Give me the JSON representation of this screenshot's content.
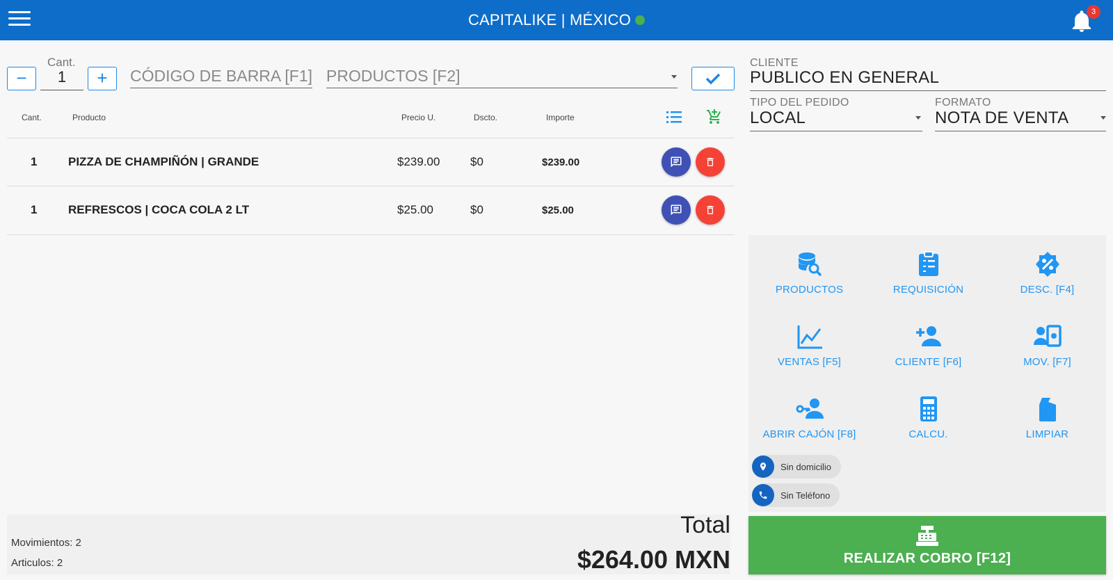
{
  "header": {
    "title": "CAPITALIKE | MÉXICO",
    "notifications": "3"
  },
  "entry": {
    "qty_label": "Cant.",
    "qty_value": "1",
    "barcode_placeholder": "CÓDIGO DE BARRA [F1]",
    "products_placeholder": "PRODUCTOS [F2]"
  },
  "table": {
    "headers": {
      "qty": "Cant.",
      "product": "Producto",
      "price": "Precio U.",
      "discount": "Dscto.",
      "amount": "Importe"
    },
    "rows": [
      {
        "qty": "1",
        "product": "PIZZA DE CHAMPIÑÓN | GRANDE",
        "price": "$239.00",
        "discount": "$0",
        "amount": "$239.00"
      },
      {
        "qty": "1",
        "product": "REFRESCOS | COCA COLA 2 LT",
        "price": "$25.00",
        "discount": "$0",
        "amount": "$25.00"
      }
    ]
  },
  "customer": {
    "client_label": "CLIENTE",
    "client_value": "PUBLICO EN GENERAL",
    "order_type_label": "TIPO DEL PEDIDO",
    "order_type_value": "LOCAL",
    "format_label": "FORMATO",
    "format_value": "NOTA DE VENTA"
  },
  "actions": [
    {
      "label": "PRODUCTOS",
      "icon": "database-search-icon"
    },
    {
      "label": "REQUISICIÓN",
      "icon": "clipboard-list-icon"
    },
    {
      "label": "DESC. [F4]",
      "icon": "discount-badge-icon"
    },
    {
      "label": "VENTAS [F5]",
      "icon": "line-chart-icon"
    },
    {
      "label": "CLIENTE [F6]",
      "icon": "add-user-icon"
    },
    {
      "label": "MOV. [F7]",
      "icon": "cash-movement-icon"
    },
    {
      "label": "ABRIR CAJÓN [F8]",
      "icon": "key-user-icon"
    },
    {
      "label": "CALCU.",
      "icon": "calculator-icon"
    },
    {
      "label": "LIMPIAR",
      "icon": "clear-file-icon"
    }
  ],
  "chips": {
    "address": "Sin domicilio",
    "phone": "Sin Teléfono"
  },
  "summary": {
    "movements": "Movimientos: 2",
    "articles": "Articulos: 2",
    "total_label": "Total",
    "total_value": "$264.00 MXN"
  },
  "pay_button": "REALIZAR COBRO [F12]",
  "colors": {
    "primary": "#0d6dc9",
    "accent": "#2196f3",
    "success": "#4caf50",
    "danger": "#f44336",
    "indigo": "#3f51b5"
  }
}
